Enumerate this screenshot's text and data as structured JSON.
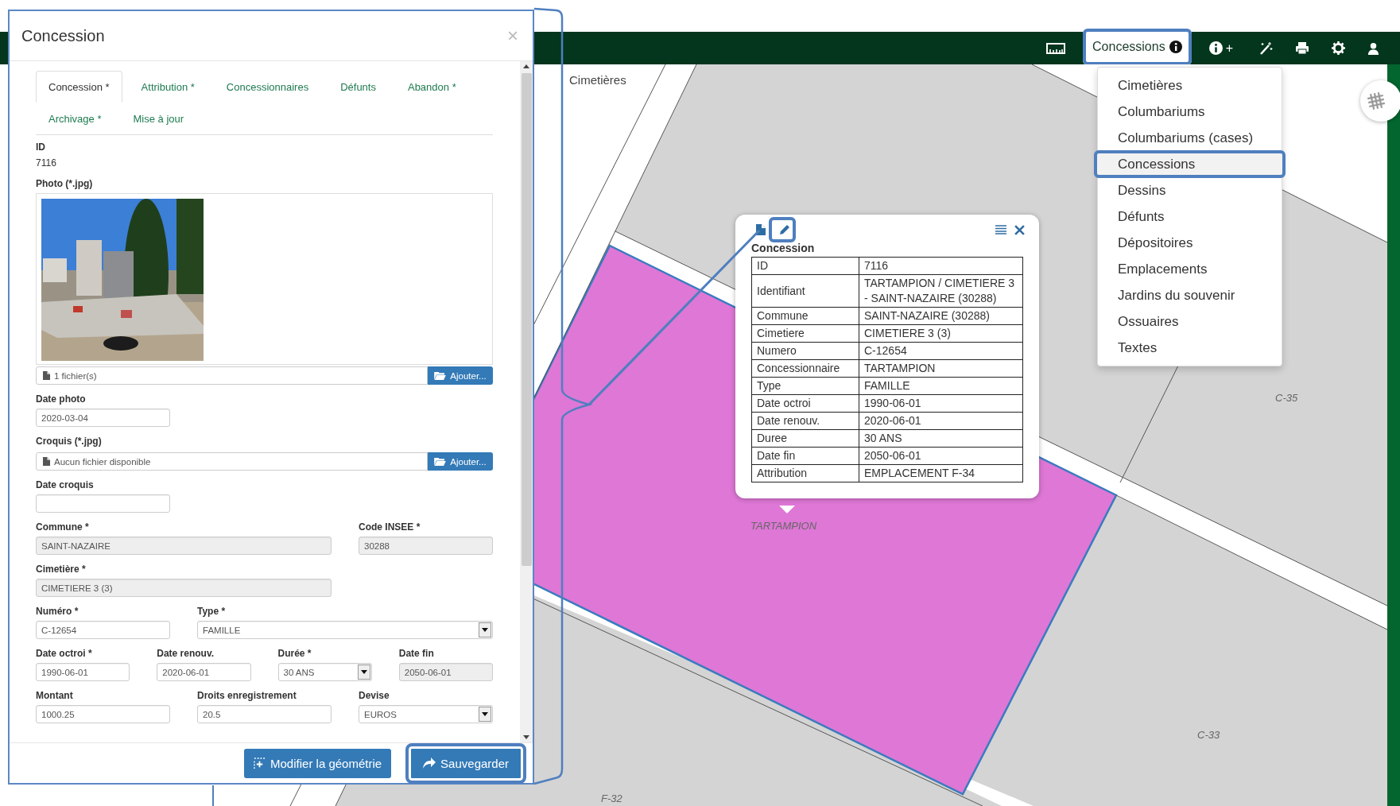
{
  "dialog": {
    "title": "Concession",
    "close": "×",
    "tabs": [
      {
        "label": "Concession *",
        "selected": true
      },
      {
        "label": "Attribution *",
        "selected": false
      },
      {
        "label": "Concessionnaires",
        "selected": false
      },
      {
        "label": "Défunts",
        "selected": false
      },
      {
        "label": "Abandon *",
        "selected": false
      },
      {
        "label": "Archivage *",
        "selected": false
      },
      {
        "label": "Mise à jour",
        "selected": false
      }
    ],
    "rows": [
      [
        {
          "kind": "static",
          "label": "ID",
          "value": "7116"
        }
      ],
      [
        {
          "label": "Photo (*.jpg)",
          "file_text": "1 fichier(s)",
          "button": "Ajouter..."
        }
      ],
      [
        {
          "kind": "text",
          "label": "Date photo",
          "value": "2020-03-04",
          "disabled": false
        }
      ],
      [
        {
          "kind": "file",
          "label": "Croquis (*.jpg)",
          "file_text": "Aucun fichier disponible",
          "button": "Ajouter..."
        }
      ],
      [
        {
          "kind": "text",
          "label": "Date croquis",
          "disabled": false
        }
      ],
      [
        {
          "kind": "text",
          "label": "Commune *",
          "value": "SAINT-NAZAIRE",
          "disabled": true
        },
        {
          "kind": "text",
          "label": "Code INSEE *",
          "value": "30288",
          "disabled": true
        }
      ],
      [
        {
          "kind": "text",
          "label": "Cimetière *",
          "value": "CIMETIERE 3 (3)",
          "disabled": true
        }
      ],
      [
        {
          "kind": "text",
          "label": "Numéro *",
          "value": "C-12654",
          "disabled": false
        },
        {
          "kind": "select",
          "label": "Type *",
          "value": "FAMILLE",
          "disabled": false
        }
      ],
      [
        {
          "kind": "text",
          "label": "Date octroi *",
          "value": "1990-06-01",
          "disabled": false
        },
        {
          "kind": "text",
          "label": "Date renouv.",
          "value": "2020-06-01",
          "disabled": false
        },
        {
          "kind": "select",
          "label": "Durée *",
          "value": "30 ANS",
          "disabled": false
        },
        {
          "kind": "text",
          "label": "Date fin",
          "value": "2050-06-01",
          "disabled": true
        }
      ],
      [
        {
          "kind": "text",
          "label": "Montant",
          "value": "1000.25",
          "disabled": false
        },
        {
          "kind": "text",
          "label": "Droits enregistrement",
          "value": "20.5",
          "disabled": false
        },
        {
          "kind": "select",
          "label": "Devise",
          "value": "EUROS",
          "disabled": false
        }
      ]
    ],
    "buttons": [
      {
        "kind": "geometry",
        "label": "Modifier la géométrie",
        "highlighted": false
      },
      {
        "kind": "save",
        "label": "Sauvegarder",
        "highlighted": true
      }
    ]
  },
  "map": {
    "toolbar": [
      {
        "kind": "ruler"
      },
      {
        "kind": "layers",
        "label": "Concessions",
        "highlighted": true
      },
      {
        "kind": "info-add",
        "label": "+"
      },
      {
        "kind": "wand"
      },
      {
        "kind": "print"
      },
      {
        "kind": "settings"
      },
      {
        "kind": "user"
      }
    ],
    "layer_menu": [
      {
        "label": "Cimetières",
        "selected": false
      },
      {
        "label": "Columbariums",
        "selected": false
      },
      {
        "label": "Columbariums (cases)",
        "selected": false
      },
      {
        "label": "Concessions",
        "selected": true
      },
      {
        "label": "Dessins",
        "selected": false
      },
      {
        "label": "Défunts",
        "selected": false
      },
      {
        "label": "Dépositoires",
        "selected": false
      },
      {
        "label": "Emplacements",
        "selected": false
      },
      {
        "label": "Jardins du souvenir",
        "selected": false
      },
      {
        "label": "Ossuaires",
        "selected": false
      },
      {
        "label": "Textes",
        "selected": false
      }
    ],
    "labels": [
      {
        "kind": "layer",
        "text": "Cimetières"
      },
      {
        "kind": "parcel",
        "text": "TARTAMPION"
      },
      {
        "kind": "parcel",
        "text": "C-35"
      },
      {
        "kind": "parcel",
        "text": "C-33"
      },
      {
        "kind": "parcel",
        "text": "F-32"
      }
    ],
    "popup": {
      "title": "Concession",
      "edit_highlighted": true,
      "rows": [
        {
          "field": "ID",
          "value": "7116"
        },
        {
          "field": "Identifiant",
          "value": "TARTAMPION / CIMETIERE 3 - SAINT-NAZAIRE (30288)"
        },
        {
          "field": "Commune",
          "value": "SAINT-NAZAIRE (30288)"
        },
        {
          "field": "Cimetiere",
          "value": "CIMETIERE 3 (3)"
        },
        {
          "field": "Numero",
          "value": "C-12654"
        },
        {
          "field": "Concessionnaire",
          "value": "TARTAMPION"
        },
        {
          "field": "Type",
          "value": "FAMILLE"
        },
        {
          "field": "Date octroi",
          "value": "1990-06-01"
        },
        {
          "field": "Date renouv.",
          "value": "2020-06-01"
        },
        {
          "field": "Duree",
          "value": "30 ANS"
        },
        {
          "field": "Date fin",
          "value": "2050-06-01"
        },
        {
          "field": "Attribution",
          "value": "EMPLACEMENT F-34"
        }
      ]
    }
  }
}
